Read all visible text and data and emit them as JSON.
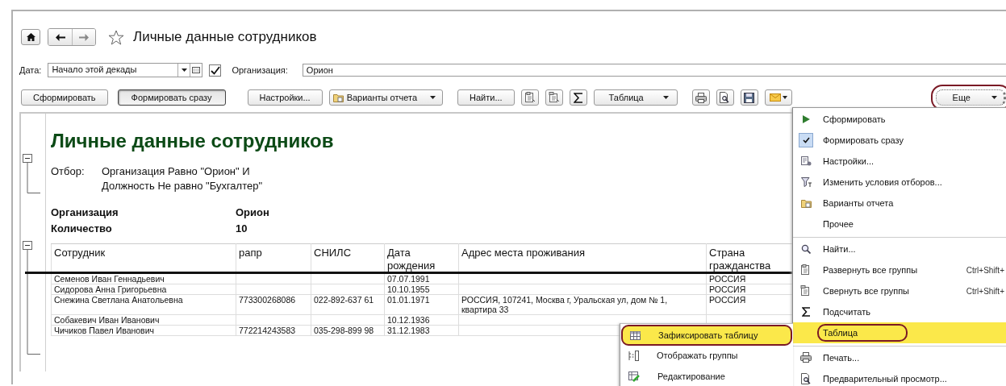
{
  "window": {
    "title": "Личные данные сотрудников",
    "favorite": false
  },
  "filters": {
    "date_label": "Дата:",
    "date_value": "Начало этой декады",
    "org_enabled": true,
    "org_label": "Организация:",
    "org_value": "Орион"
  },
  "toolbar": {
    "groups": [
      [
        {
          "kind": "button",
          "label": "Сформировать",
          "pressed": false
        },
        {
          "kind": "button",
          "label": "Формировать сразу",
          "pressed": true
        }
      ],
      [
        {
          "kind": "button",
          "label": "Настройки...",
          "pressed": false
        },
        {
          "kind": "variants",
          "label": "Варианты отчета",
          "pressed": false
        }
      ],
      [
        {
          "kind": "button",
          "label": "Найти...",
          "pressed": false
        },
        {
          "kind": "expand",
          "pressed": false
        },
        {
          "kind": "collapse",
          "pressed": false
        },
        {
          "kind": "sum",
          "pressed": false
        },
        {
          "kind": "dropdown",
          "label": "Таблица",
          "pressed": false
        }
      ],
      [
        {
          "kind": "print",
          "pressed": false
        },
        {
          "kind": "preview",
          "pressed": false
        },
        {
          "kind": "save",
          "pressed": false
        },
        {
          "kind": "mail",
          "pressed": false
        }
      ]
    ],
    "more": {
      "label": "Еще",
      "highlighted": true
    }
  },
  "report": {
    "title": "Личные данные сотрудников",
    "filter_label": "Отбор:",
    "filter_lines": [
      "Организация Равно \"Орион\" И",
      "Должность Не равно \"Бухгалтер\""
    ],
    "summary": [
      {
        "label": "Организация",
        "value": "Орион"
      },
      {
        "label": "Количество",
        "value": "10"
      }
    ],
    "header_underlined": true,
    "columns": [
      "Сотрудник",
      "рапр",
      "СНИЛС",
      "Дата рождения",
      "Адрес места проживания",
      "Страна гражданства"
    ],
    "rows": [
      [
        "Семенов Иван Геннадьевич",
        "",
        "",
        "07.07.1991",
        "",
        "РОССИЯ"
      ],
      [
        "Сидорова Анна Григорьевна",
        "",
        "",
        "10.10.1955",
        "",
        "РОССИЯ"
      ],
      [
        "Снежина Светлана Анатольевна",
        "773300268086",
        "022-892-637 61",
        "01.01.1971",
        "РОССИЯ, 107241, Москва г, Уральская ул, дом № 1, квартира 33",
        "РОССИЯ"
      ],
      [
        "Собакевич Иван Иванович",
        "",
        "",
        "10.12.1936",
        "",
        ""
      ],
      [
        "Чичиков Павел Иванович",
        "772214243583",
        "035-298-899 98",
        "31.12.1983",
        "",
        ""
      ]
    ]
  },
  "menu": [
    {
      "kind": "play",
      "label": "Сформировать",
      "checked": false,
      "selected": false,
      "highlighted": false,
      "separator_before": false
    },
    {
      "kind": "check",
      "label": "Формировать сразу",
      "checked": true,
      "selected": false,
      "highlighted": false,
      "separator_before": false
    },
    {
      "kind": "settings",
      "label": "Настройки...",
      "checked": false,
      "selected": false,
      "highlighted": false,
      "separator_before": false
    },
    {
      "kind": "filter",
      "label": "Изменить условия отборов...",
      "checked": false,
      "selected": false,
      "highlighted": false,
      "separator_before": false
    },
    {
      "kind": "variants",
      "label": "Варианты отчета",
      "checked": false,
      "selected": false,
      "highlighted": false,
      "separator_before": false
    },
    {
      "kind": "none",
      "label": "Прочее",
      "checked": false,
      "selected": false,
      "highlighted": false,
      "separator_before": false
    },
    {
      "kind": "search",
      "label": "Найти...",
      "checked": false,
      "selected": false,
      "highlighted": false,
      "separator_before": true
    },
    {
      "kind": "expand",
      "label": "Развернуть все группы",
      "shortcut": "Ctrl+Shift+",
      "checked": false,
      "selected": false,
      "highlighted": false,
      "separator_before": false
    },
    {
      "kind": "collapse",
      "label": "Свернуть все группы",
      "shortcut": "Ctrl+Shift+",
      "checked": false,
      "selected": false,
      "highlighted": false,
      "separator_before": false
    },
    {
      "kind": "sum",
      "label": "Подсчитать",
      "checked": false,
      "selected": false,
      "highlighted": false,
      "separator_before": false
    },
    {
      "kind": "none",
      "label": "Таблица",
      "checked": false,
      "selected": true,
      "highlighted": true,
      "separator_before": false
    },
    {
      "kind": "print",
      "label": "Печать...",
      "checked": false,
      "selected": false,
      "highlighted": false,
      "separator_before": true
    },
    {
      "kind": "preview",
      "label": "Предварительный просмотр...",
      "checked": false,
      "selected": false,
      "highlighted": false,
      "separator_before": false
    }
  ],
  "submenu": [
    {
      "kind": "table",
      "label": "Зафиксировать таблицу",
      "selected": true,
      "highlighted": true
    },
    {
      "kind": "groups",
      "label": "Отображать группы",
      "selected": false,
      "highlighted": false
    },
    {
      "kind": "edit",
      "label": "Редактирование",
      "selected": false,
      "highlighted": false
    }
  ]
}
